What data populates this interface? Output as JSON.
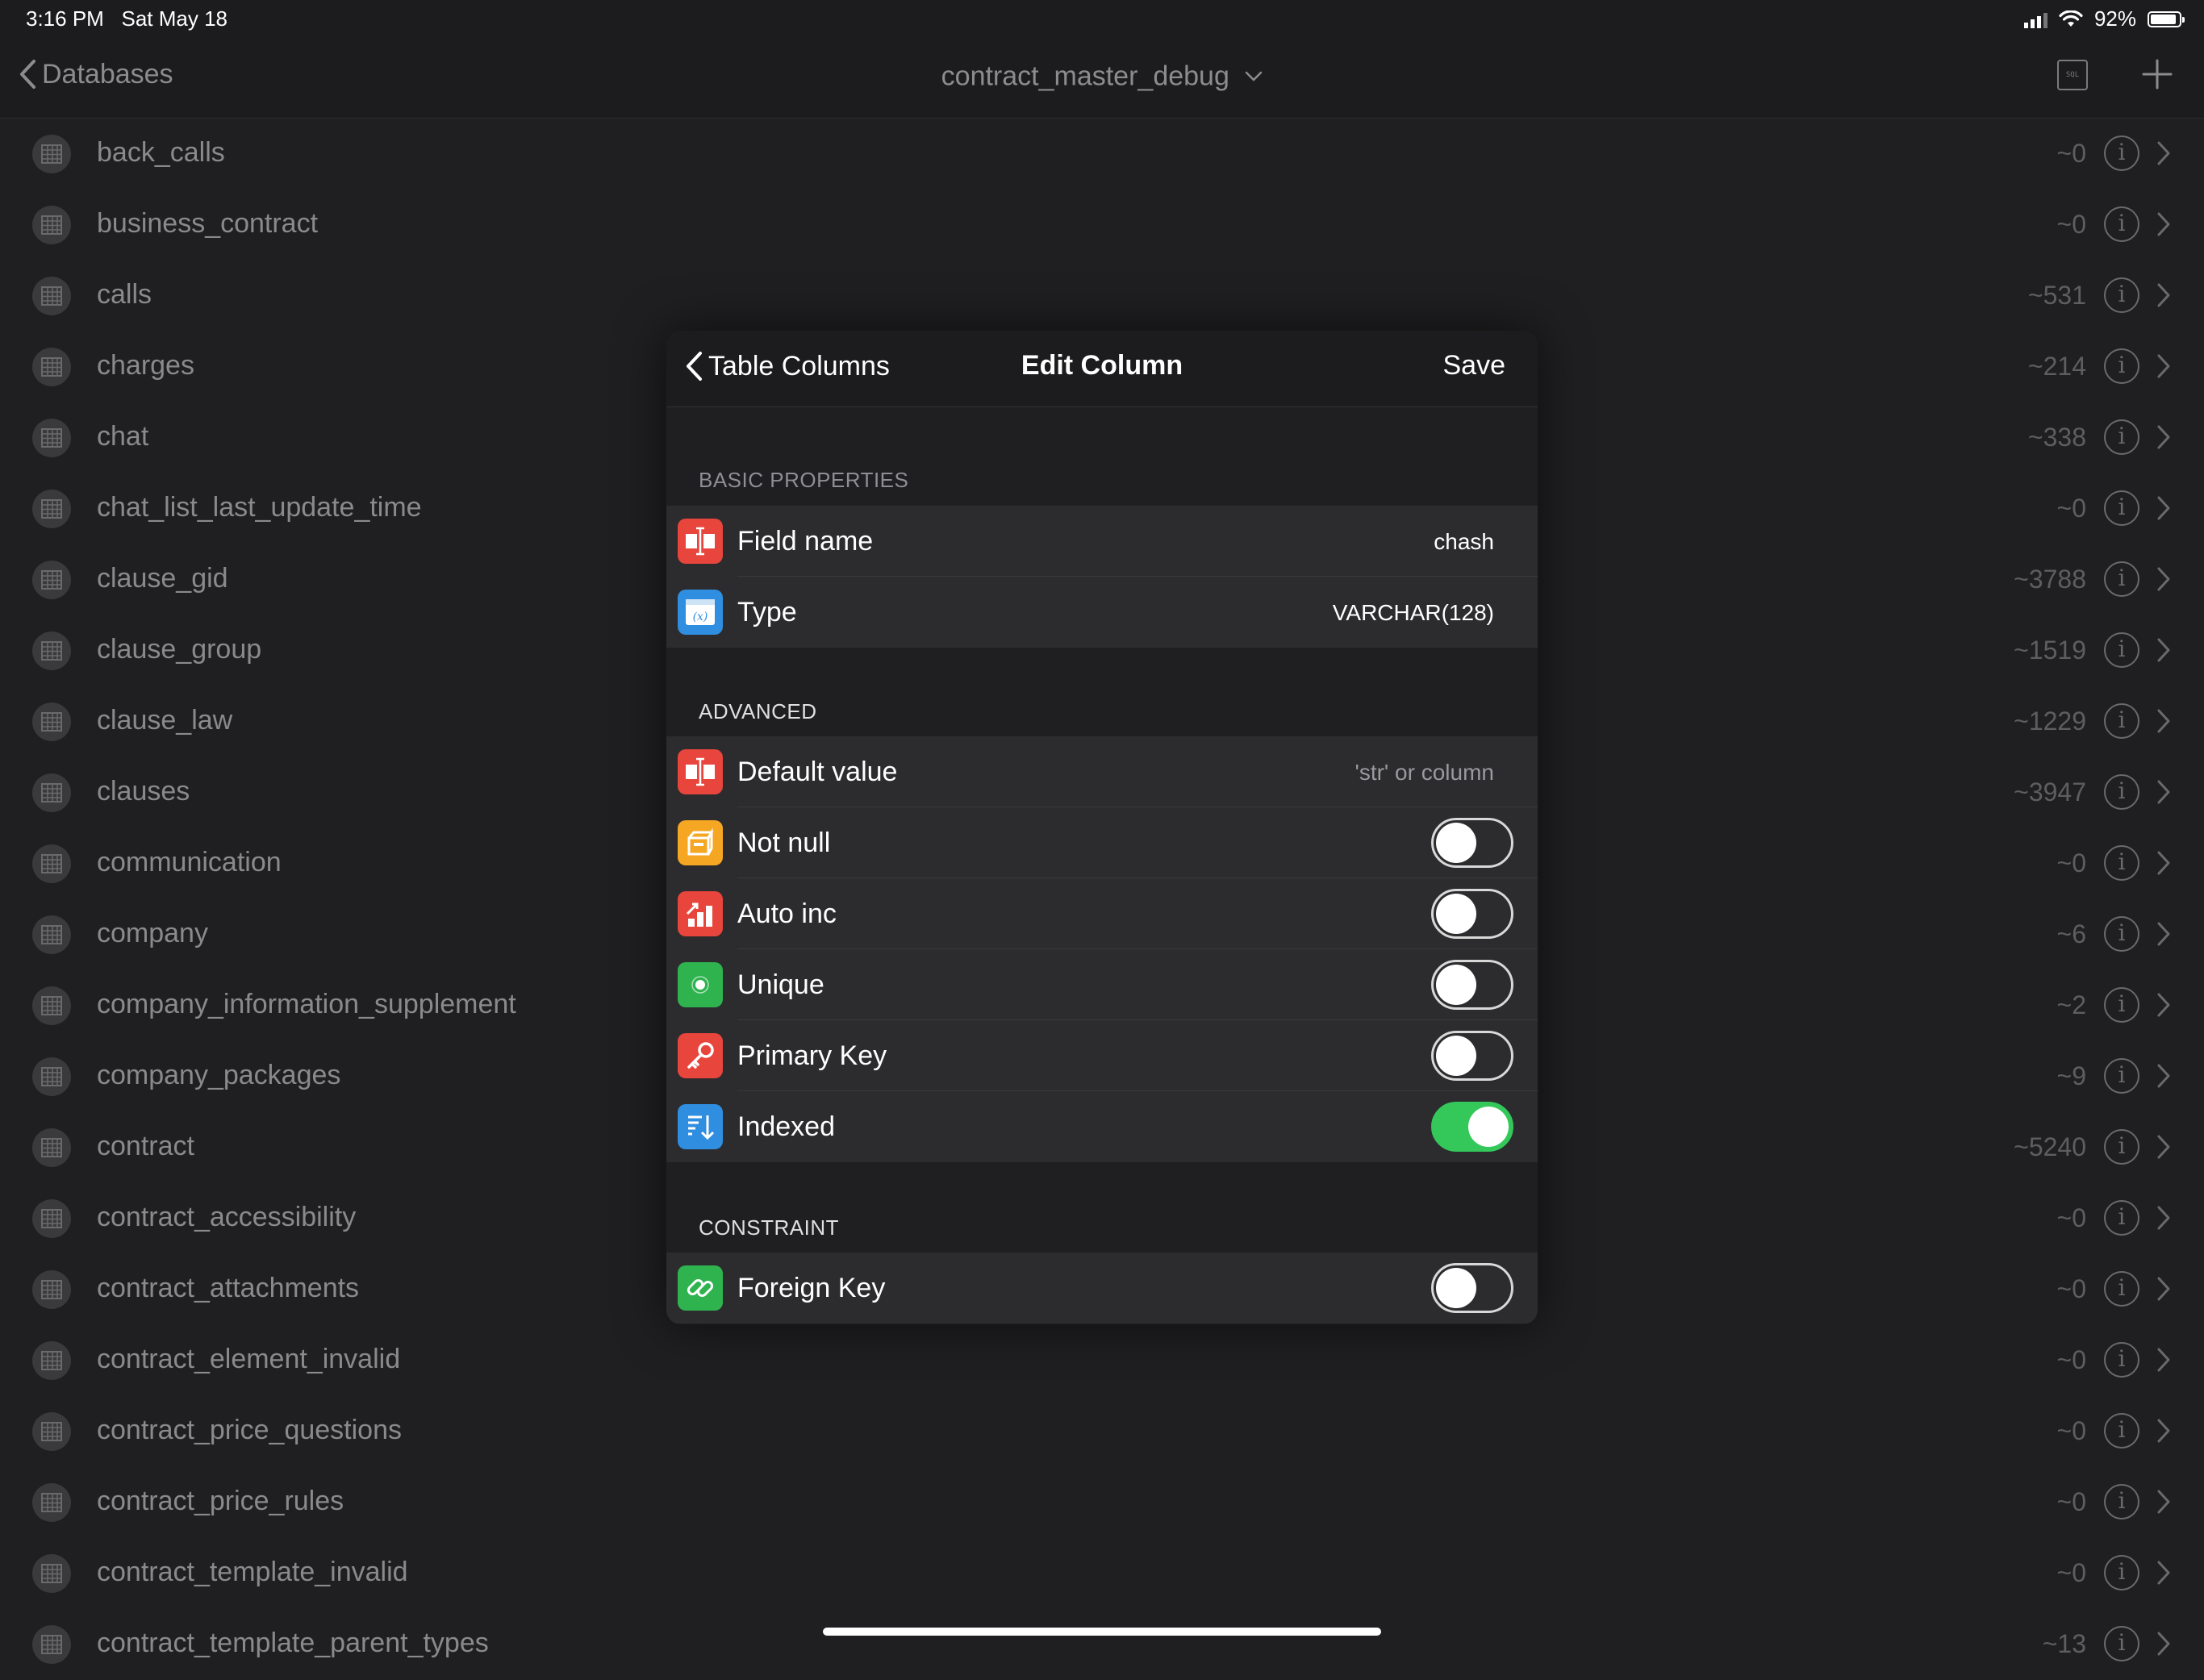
{
  "status_bar": {
    "time": "3:16 PM",
    "date": "Sat May 18",
    "battery": "92%",
    "battery_level": 0.92
  },
  "nav": {
    "back_label": "Databases",
    "title": "contract_master_debug",
    "sql_label": "SQL"
  },
  "tables": [
    {
      "name": "back_calls",
      "count": "~0"
    },
    {
      "name": "business_contract",
      "count": "~0"
    },
    {
      "name": "calls",
      "count": "~531"
    },
    {
      "name": "charges",
      "count": "~214"
    },
    {
      "name": "chat",
      "count": "~338"
    },
    {
      "name": "chat_list_last_update_time",
      "count": "~0"
    },
    {
      "name": "clause_gid",
      "count": "~3788"
    },
    {
      "name": "clause_group",
      "count": "~1519"
    },
    {
      "name": "clause_law",
      "count": "~1229"
    },
    {
      "name": "clauses",
      "count": "~3947"
    },
    {
      "name": "communication",
      "count": "~0"
    },
    {
      "name": "company",
      "count": "~6"
    },
    {
      "name": "company_information_supplement",
      "count": "~2"
    },
    {
      "name": "company_packages",
      "count": "~9"
    },
    {
      "name": "contract",
      "count": "~5240"
    },
    {
      "name": "contract_accessibility",
      "count": "~0"
    },
    {
      "name": "contract_attachments",
      "count": "~0"
    },
    {
      "name": "contract_element_invalid",
      "count": "~0"
    },
    {
      "name": "contract_price_questions",
      "count": "~0"
    },
    {
      "name": "contract_price_rules",
      "count": "~0"
    },
    {
      "name": "contract_template_invalid",
      "count": "~0"
    },
    {
      "name": "contract_template_parent_types",
      "count": "~13"
    }
  ],
  "modal": {
    "back_label": "Table Columns",
    "title": "Edit Column",
    "save_label": "Save",
    "sections": {
      "basic": "BASIC PROPERTIES",
      "advanced": "ADVANCED",
      "constraint": "CONSTRAINT"
    },
    "field_name": {
      "label": "Field name",
      "value": "chash"
    },
    "type": {
      "label": "Type",
      "value": "VARCHAR(128)"
    },
    "default_value": {
      "label": "Default value",
      "placeholder": "'str' or column"
    },
    "not_null": {
      "label": "Not null",
      "on": false
    },
    "auto_inc": {
      "label": "Auto inc",
      "on": false
    },
    "unique": {
      "label": "Unique",
      "on": false
    },
    "primary_key": {
      "label": "Primary Key",
      "on": false
    },
    "indexed": {
      "label": "Indexed",
      "on": true
    },
    "foreign_key": {
      "label": "Foreign Key",
      "on": false
    }
  },
  "colors": {
    "background": "#1f1f21",
    "cell": "#2c2c2e",
    "toggle_on": "#34c759",
    "icon_red": "#e8453c",
    "icon_blue": "#2f8ee0",
    "icon_orange": "#f5a623",
    "icon_green": "#2fb34f"
  },
  "icons": {
    "field_name": "text-cursor-icon",
    "type": "variable-icon",
    "default_value": "text-cursor-icon",
    "not_null": "box-icon",
    "auto_inc": "bar-chart-icon",
    "unique": "radio-icon",
    "primary_key": "key-icon",
    "indexed": "sort-icon",
    "foreign_key": "link-icon"
  }
}
